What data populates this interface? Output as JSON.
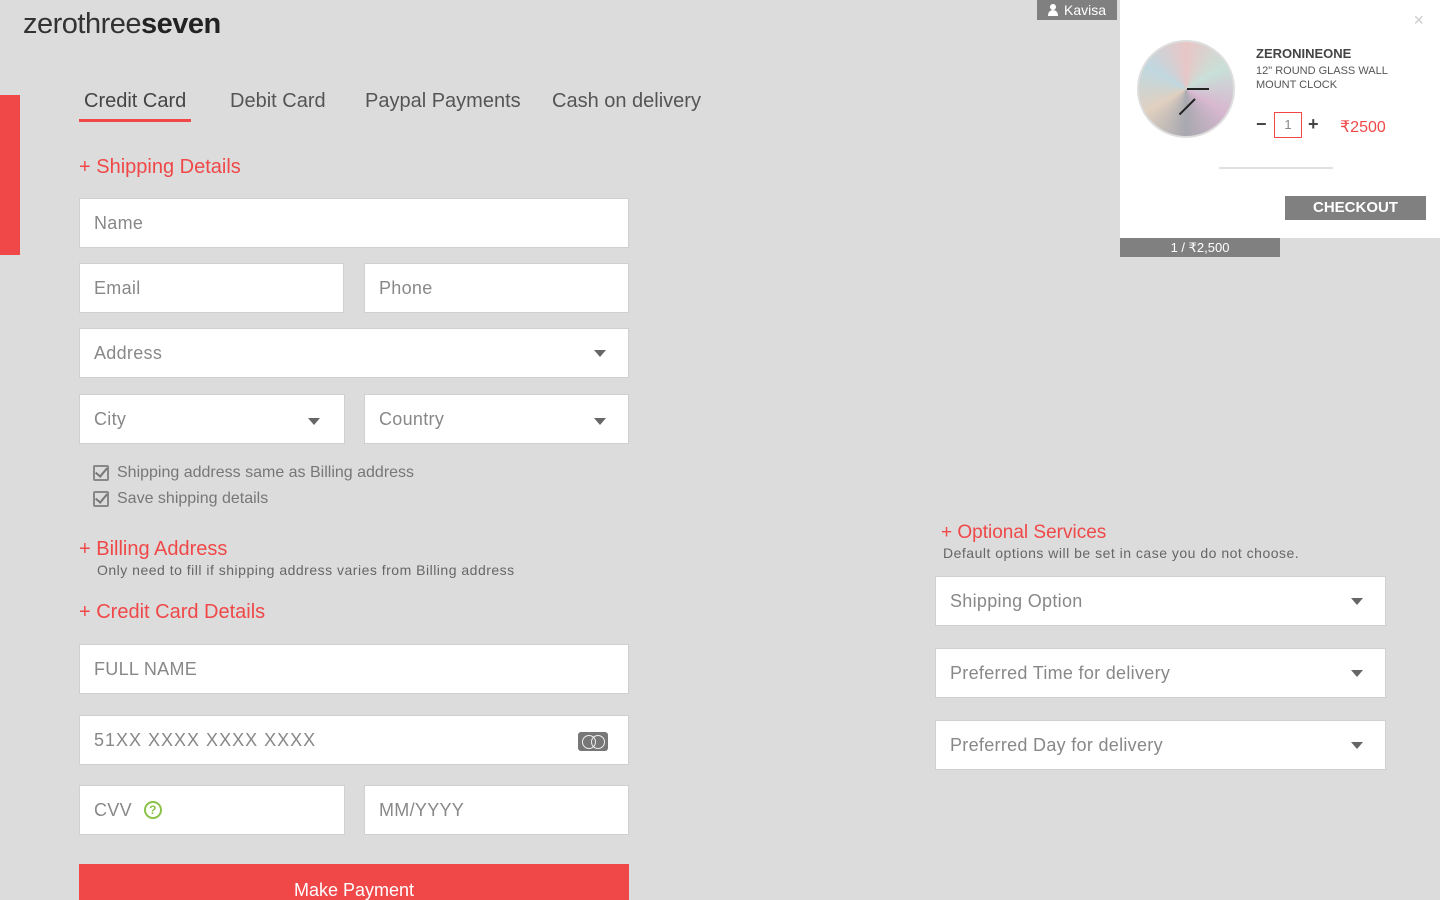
{
  "logo": {
    "part1": "zero",
    "part2": "three",
    "part3": "seven"
  },
  "tabs": [
    {
      "label": "Credit Card",
      "active": true
    },
    {
      "label": "Debit Card",
      "active": false
    },
    {
      "label": "Paypal Payments",
      "active": false
    },
    {
      "label": "Cash on delivery",
      "active": false
    }
  ],
  "shipping": {
    "title": "+ Shipping Details",
    "name_placeholder": "Name",
    "email_placeholder": "Email",
    "phone_placeholder": "Phone",
    "address_placeholder": "Address",
    "city_placeholder": "City",
    "country_placeholder": "Country",
    "check_same_billing": "Shipping address same as Billing address",
    "check_save": "Save shipping details"
  },
  "billing": {
    "title": "+ Billing Address",
    "subtitle": "Only need to fill if shipping address varies from Billing address"
  },
  "credit_card": {
    "title": "+ Credit Card Details",
    "full_name_placeholder": "FULL NAME",
    "number_placeholder": "51XX XXXX XXXX XXXX",
    "cvv_placeholder": "CVV",
    "help_icon_glyph": "?",
    "expiry_placeholder": "MM/YYYY",
    "pay_label": "Make Payment"
  },
  "optional": {
    "title": "+ Optional Services",
    "subtitle": "Default options will be set in case you do not choose.",
    "shipping_option": "Shipping Option",
    "preferred_time": "Preferred Time for delivery",
    "preferred_day": "Preferred Day for delivery"
  },
  "user": {
    "name": "Kavisa"
  },
  "cart": {
    "close_glyph": "×",
    "brand": "ZERONINEONE",
    "product_name": "12\" ROUND GLASS WALL MOUNT CLOCK",
    "minus_glyph": "−",
    "plus_glyph": "+",
    "quantity": "1",
    "price": "₹2500",
    "checkout_label": "CHECKOUT",
    "summary": "1 /  ₹2,500"
  },
  "colors": {
    "accent": "#f04848",
    "background": "#dcdcdc",
    "button_gray": "#808080",
    "help_green": "#8bc34a"
  }
}
